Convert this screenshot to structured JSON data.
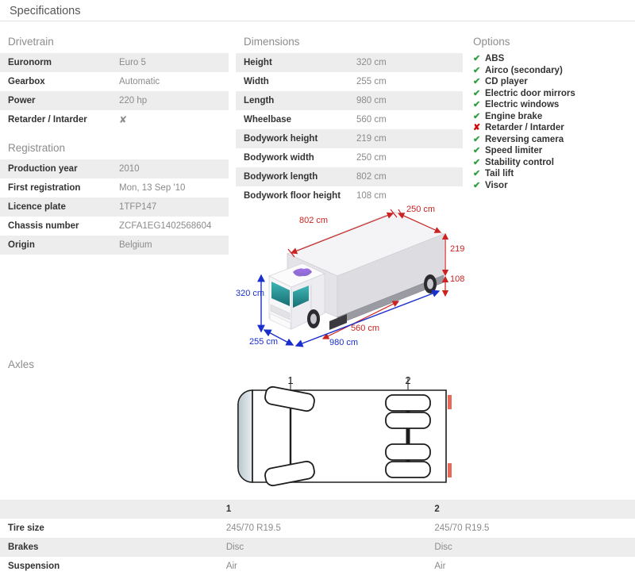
{
  "header": {
    "title": "Specifications"
  },
  "drivetrain": {
    "heading": "Drivetrain",
    "rows": [
      {
        "label": "Euronorm",
        "value": "Euro 5"
      },
      {
        "label": "Gearbox",
        "value": "Automatic"
      },
      {
        "label": "Power",
        "value": "220 hp"
      },
      {
        "label": "Retarder / Intarder",
        "value": "✘"
      }
    ]
  },
  "registration": {
    "heading": "Registration",
    "rows": [
      {
        "label": "Production year",
        "value": "2010"
      },
      {
        "label": "First registration",
        "value": "Mon, 13 Sep '10"
      },
      {
        "label": "Licence plate",
        "value": "1TFP147"
      },
      {
        "label": "Chassis number",
        "value": "ZCFA1EG1402568604"
      },
      {
        "label": "Origin",
        "value": "Belgium"
      }
    ]
  },
  "dimensions": {
    "heading": "Dimensions",
    "rows": [
      {
        "label": "Height",
        "value": "320 cm"
      },
      {
        "label": "Width",
        "value": "255 cm"
      },
      {
        "label": "Length",
        "value": "980 cm"
      },
      {
        "label": "Wheelbase",
        "value": "560 cm"
      },
      {
        "label": "Bodywork height",
        "value": "219 cm"
      },
      {
        "label": "Bodywork width",
        "value": "250 cm"
      },
      {
        "label": "Bodywork length",
        "value": "802 cm"
      },
      {
        "label": "Bodywork floor height",
        "value": "108 cm"
      }
    ]
  },
  "options": {
    "heading": "Options",
    "items": [
      {
        "label": "ABS",
        "available": true,
        "mark": "✔"
      },
      {
        "label": "Airco (secondary)",
        "available": true,
        "mark": "✔"
      },
      {
        "label": "CD player",
        "available": true,
        "mark": "✔"
      },
      {
        "label": "Electric door mirrors",
        "available": true,
        "mark": "✔"
      },
      {
        "label": "Electric windows",
        "available": true,
        "mark": "✔"
      },
      {
        "label": "Engine brake",
        "available": true,
        "mark": "✔"
      },
      {
        "label": "Retarder / Intarder",
        "available": false,
        "mark": "✘"
      },
      {
        "label": "Reversing camera",
        "available": true,
        "mark": "✔"
      },
      {
        "label": "Speed limiter",
        "available": true,
        "mark": "✔"
      },
      {
        "label": "Stability control",
        "available": true,
        "mark": "✔"
      },
      {
        "label": "Tail lift",
        "available": true,
        "mark": "✔"
      },
      {
        "label": "Visor",
        "available": true,
        "mark": "✔"
      }
    ]
  },
  "truck_diagram": {
    "bodywork_length": "802 cm",
    "bodywork_width": "250 cm",
    "bodywork_height": "219 cm",
    "bodywork_floor_height": "108 cm",
    "wheelbase": "560 cm",
    "height": "320 cm",
    "width": "255 cm",
    "length": "980 cm",
    "colors": {
      "red": "#cc2222",
      "blue": "#1a2ecc",
      "body_side": "#d9d9de",
      "body_top": "#f2f2f4",
      "cab": "#fbfbfc",
      "glass": "#2e9a9a",
      "graphic": "#7a52cc"
    }
  },
  "axles_diagram": {
    "labels": [
      "1",
      "2"
    ],
    "taillight_color": "#e8685a"
  },
  "axles": {
    "heading": "Axles",
    "columns": [
      "",
      "1",
      "2"
    ],
    "rows": [
      {
        "label": "Tire size",
        "axle1": "245/70 R19.5",
        "axle2": "245/70 R19.5"
      },
      {
        "label": "Brakes",
        "axle1": "Disc",
        "axle2": "Disc"
      },
      {
        "label": "Suspension",
        "axle1": "Air",
        "axle2": "Air"
      }
    ]
  }
}
